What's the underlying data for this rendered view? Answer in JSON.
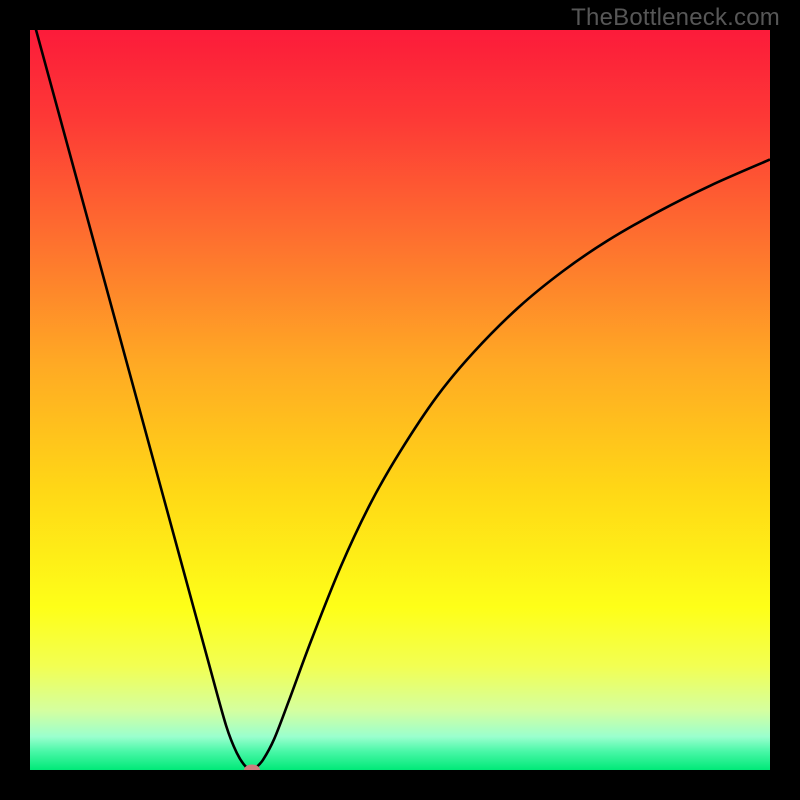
{
  "watermark": "TheBottleneck.com",
  "chart_data": {
    "type": "line",
    "title": "",
    "xlabel": "",
    "ylabel": "",
    "xlim": [
      0,
      100
    ],
    "ylim": [
      0,
      100
    ],
    "grid": false,
    "background_gradient": {
      "stops": [
        {
          "offset": 0.0,
          "color": "#fc1b3a"
        },
        {
          "offset": 0.12,
          "color": "#fd3936"
        },
        {
          "offset": 0.28,
          "color": "#fe6f2f"
        },
        {
          "offset": 0.45,
          "color": "#ffa924"
        },
        {
          "offset": 0.62,
          "color": "#ffd716"
        },
        {
          "offset": 0.78,
          "color": "#feff18"
        },
        {
          "offset": 0.86,
          "color": "#f2ff53"
        },
        {
          "offset": 0.92,
          "color": "#d4ffa0"
        },
        {
          "offset": 0.955,
          "color": "#9affce"
        },
        {
          "offset": 0.975,
          "color": "#49f7a7"
        },
        {
          "offset": 1.0,
          "color": "#00e978"
        }
      ]
    },
    "series": [
      {
        "name": "bottleneck-curve",
        "color": "#000000",
        "x": [
          0,
          3,
          6,
          9,
          12,
          15,
          18,
          21,
          24,
          26.5,
          28,
          29.2,
          30,
          30.5,
          31.5,
          33,
          35,
          38,
          42,
          46,
          50,
          55,
          60,
          66,
          72,
          78,
          85,
          92,
          100
        ],
        "y": [
          103,
          92,
          81,
          70,
          59,
          48,
          37,
          26,
          15,
          6,
          2.2,
          0.4,
          0.05,
          0.3,
          1.4,
          4.2,
          9.4,
          17.5,
          27.5,
          36,
          43,
          50.5,
          56.5,
          62.5,
          67.4,
          71.5,
          75.5,
          79,
          82.5
        ]
      }
    ],
    "marker": {
      "name": "bottleneck-marker",
      "x": 30,
      "y": 0,
      "rx": 8,
      "ry": 5.5,
      "fill": "#cf7d7e"
    }
  }
}
